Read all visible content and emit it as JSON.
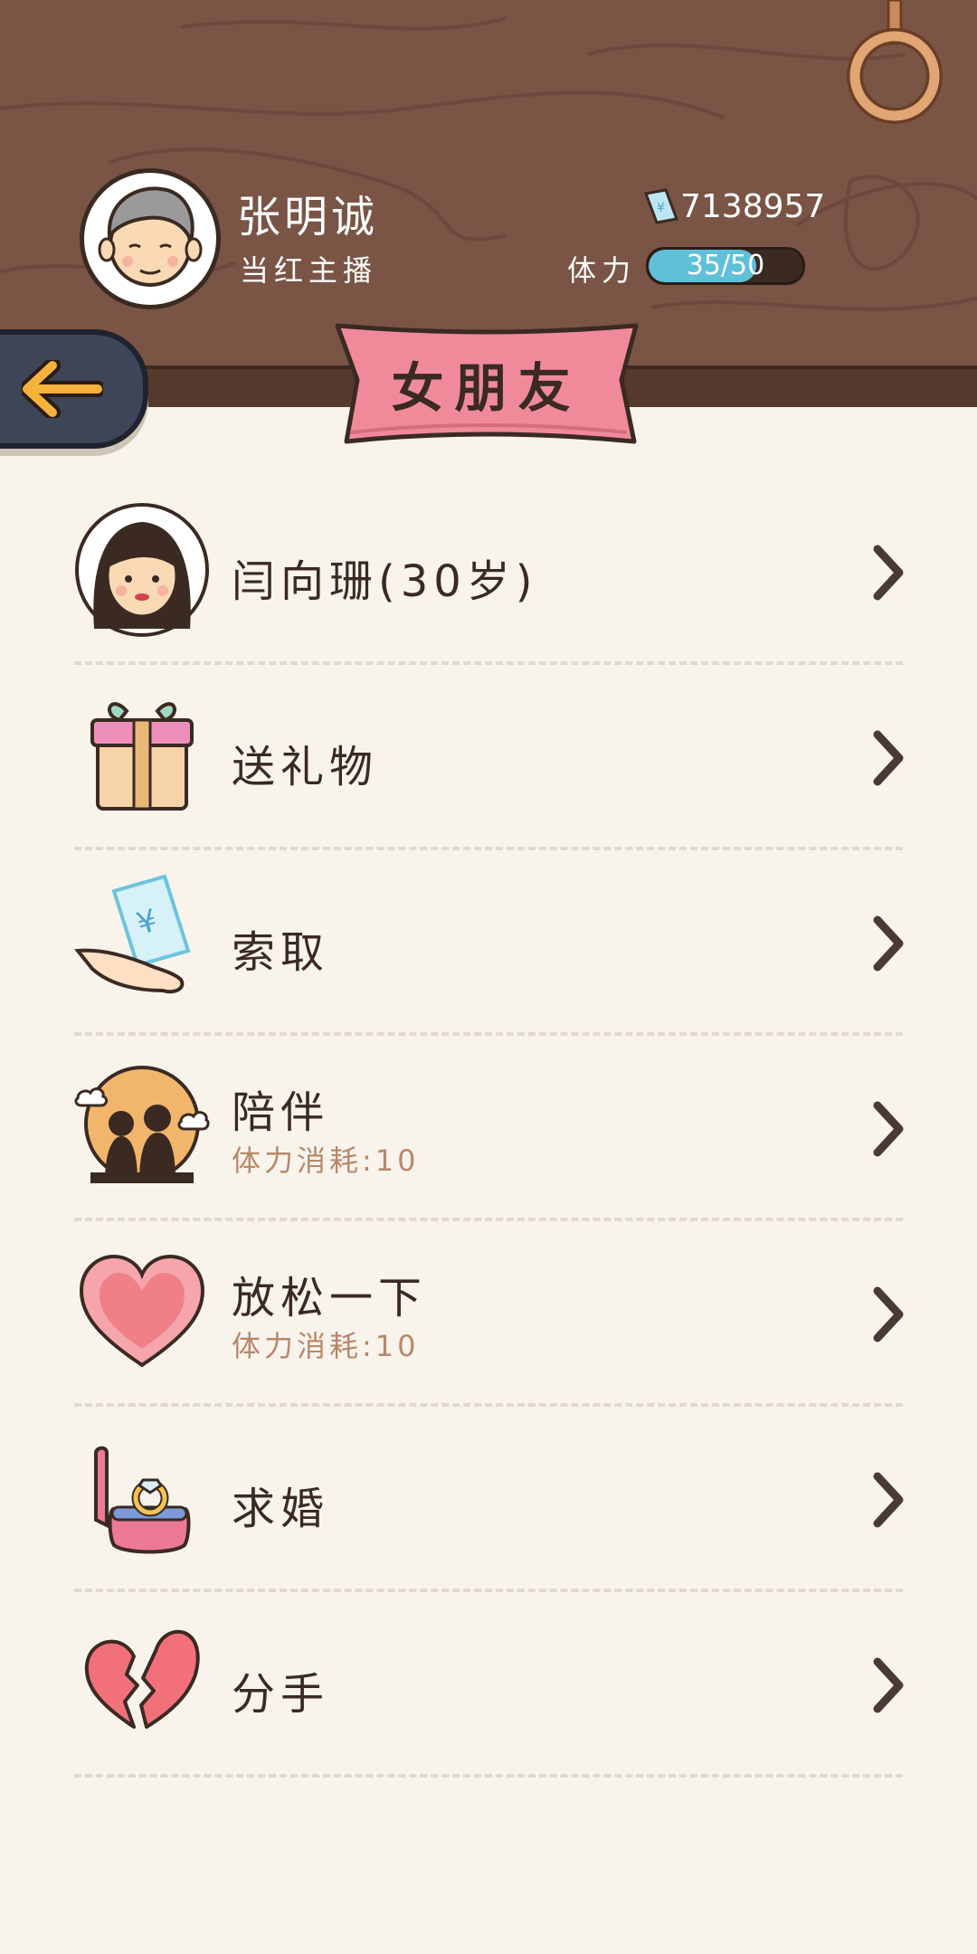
{
  "player": {
    "name": "张明诚",
    "title": "当红主播",
    "money": "7138957",
    "stamina_label": "体力",
    "stamina_text": "35/50",
    "stamina_fraction": 0.7
  },
  "page": {
    "title": "女朋友"
  },
  "menu": [
    {
      "label": "闫向珊(30岁)",
      "icon": "girlfriend-avatar-icon"
    },
    {
      "label": "送礼物",
      "icon": "gift-icon"
    },
    {
      "label": "索取",
      "icon": "money-hand-icon"
    },
    {
      "label": "陪伴",
      "sublabel": "体力消耗:10",
      "icon": "couple-icon"
    },
    {
      "label": "放松一下",
      "sublabel": "体力消耗:10",
      "icon": "heart-icon"
    },
    {
      "label": "求婚",
      "icon": "ring-box-icon"
    },
    {
      "label": "分手",
      "icon": "broken-heart-icon"
    }
  ],
  "colors": {
    "wood": "#7a5445",
    "paper": "#f8f4ec",
    "banner": "#f08a9a",
    "stamina": "#5fc0d8",
    "back_button": "#3d4556",
    "arrow": "#f7b23b"
  }
}
